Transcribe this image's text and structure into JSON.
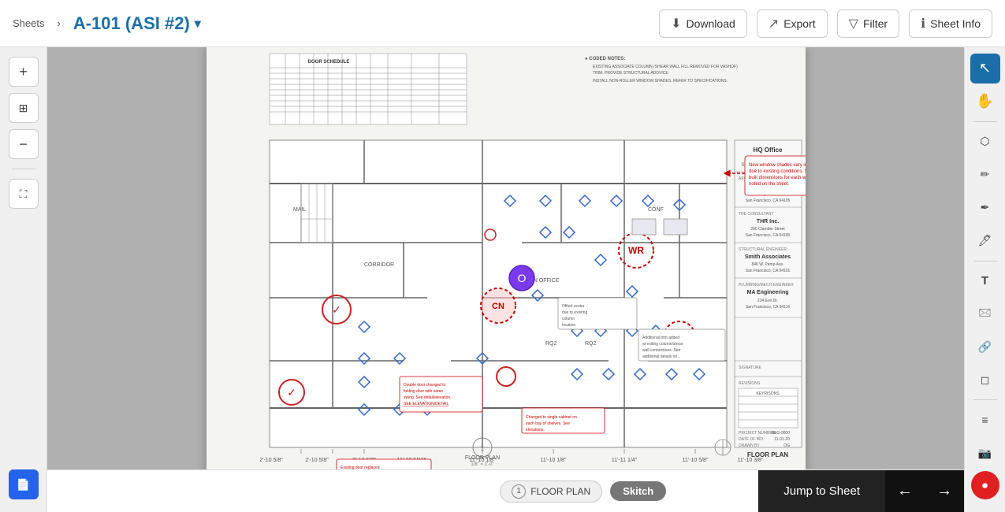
{
  "header": {
    "breadcrumb": "Sheets",
    "breadcrumb_sep": "›",
    "sheet_title": "A-101 (ASI #2)",
    "btn_download": "Download",
    "btn_export": "Export",
    "btn_filter": "Filter",
    "btn_sheet_info": "Sheet Info"
  },
  "left_sidebar": {
    "btn_add": "+",
    "btn_fit": "⊞",
    "btn_zoom_out": "−",
    "btn_fullscreen": "⛶"
  },
  "right_sidebar": {
    "tools": [
      "cursor",
      "hand",
      "lasso",
      "pen",
      "highlighter",
      "markup-pen",
      "text",
      "stamp",
      "link",
      "eraser",
      "list",
      "camera",
      "record"
    ]
  },
  "bottom": {
    "sheet_number": "1",
    "sheet_label": "FLOOR PLAN",
    "sheet_scale": "1/8\" = 1'-0\"",
    "skitch_label": "Skitch",
    "jump_label": "Jump to Sheet",
    "nav_prev": "←",
    "nav_next": "→"
  }
}
